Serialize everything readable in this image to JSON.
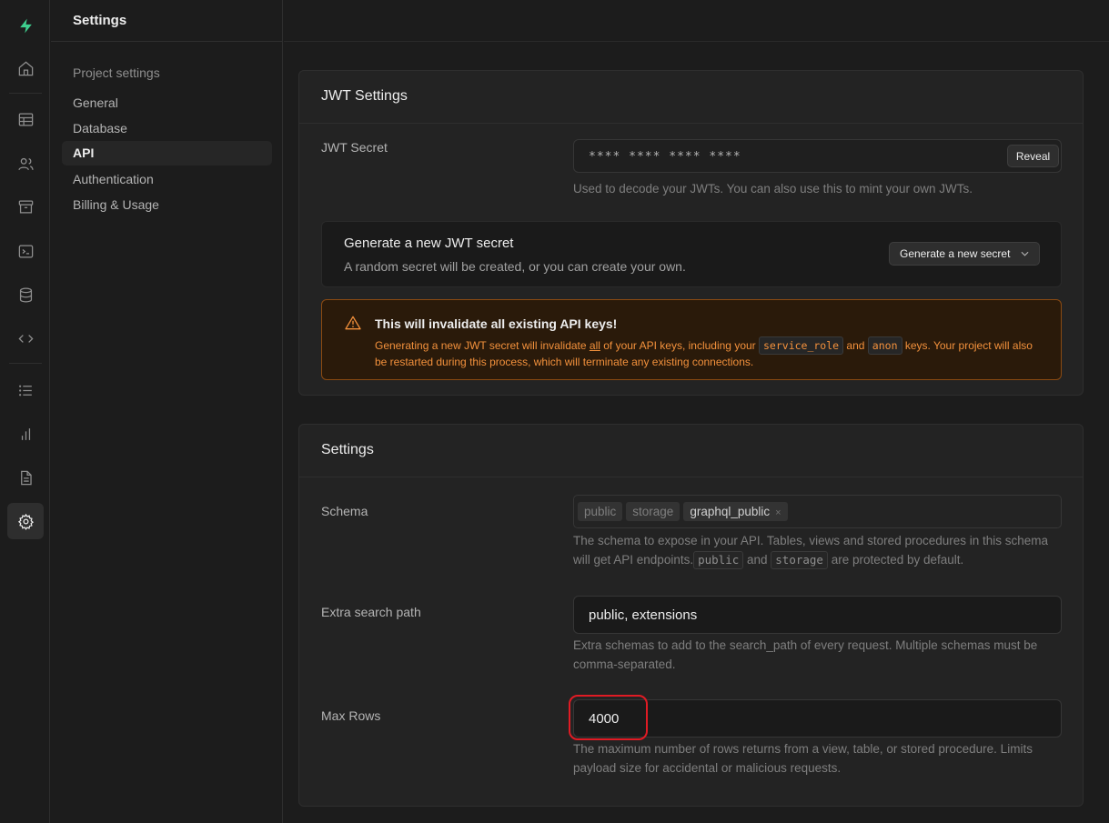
{
  "rail": {
    "items": [
      {
        "name": "home-icon"
      },
      {
        "name": "table-editor-icon"
      },
      {
        "name": "users-icon"
      },
      {
        "name": "storage-icon"
      },
      {
        "name": "sql-editor-icon"
      },
      {
        "name": "database-icon"
      },
      {
        "name": "api-docs-icon"
      },
      {
        "name": "logs-icon"
      },
      {
        "name": "reports-icon"
      },
      {
        "name": "docs-icon"
      },
      {
        "name": "settings-icon"
      }
    ],
    "active": "settings-icon",
    "brand_color": "#3ecf8e"
  },
  "menu": {
    "title": "Settings",
    "group_title": "Project settings",
    "items": [
      {
        "label": "General"
      },
      {
        "label": "Database"
      },
      {
        "label": "API",
        "active": true
      },
      {
        "label": "Authentication"
      },
      {
        "label": "Billing & Usage"
      }
    ]
  },
  "jwt": {
    "title": "JWT Settings",
    "secret_label": "JWT Secret",
    "secret_value": "**** **** **** ****",
    "reveal_label": "Reveal",
    "secret_help": "Used to decode your JWTs. You can also use this to mint your own JWTs.",
    "generate_title": "Generate a new JWT secret",
    "generate_subtitle": "A random secret will be created, or you can create your own.",
    "generate_button": "Generate a new secret",
    "warning_title": "This will invalidate all existing API keys!",
    "warning_part1": "Generating a new JWT secret will invalidate ",
    "warning_all": "all",
    "warning_part2": " of your API keys, including your ",
    "warning_chip1": "service_role",
    "warning_and": " and ",
    "warning_chip2": "anon",
    "warning_part3": " keys. Your project will also be restarted during this process, which will terminate any existing connections.",
    "warning_color": "#f3913c"
  },
  "settings": {
    "title": "Settings",
    "schema_label": "Schema",
    "schema_tags": [
      {
        "label": "public",
        "selected": false
      },
      {
        "label": "storage",
        "selected": false
      },
      {
        "label": "graphql_public",
        "selected": true,
        "remove": "×"
      }
    ],
    "schema_help_part1": "The schema to expose in your API. Tables, views and stored procedures in this schema will get API endpoints.",
    "schema_help_chip1": "public",
    "schema_help_and": " and ",
    "schema_help_chip2": "storage",
    "schema_help_part2": " are protected by default.",
    "search_path_label": "Extra search path",
    "search_path_value": "public, extensions",
    "search_path_help": "Extra schemas to add to the search_path of every request. Multiple schemas must be comma-separated.",
    "max_rows_label": "Max Rows",
    "max_rows_value": "4000",
    "max_rows_help": "The maximum number of rows returns from a view, table, or stored procedure. Limits payload size for accidental or malicious requests.",
    "highlight_color": "#e01b24"
  }
}
